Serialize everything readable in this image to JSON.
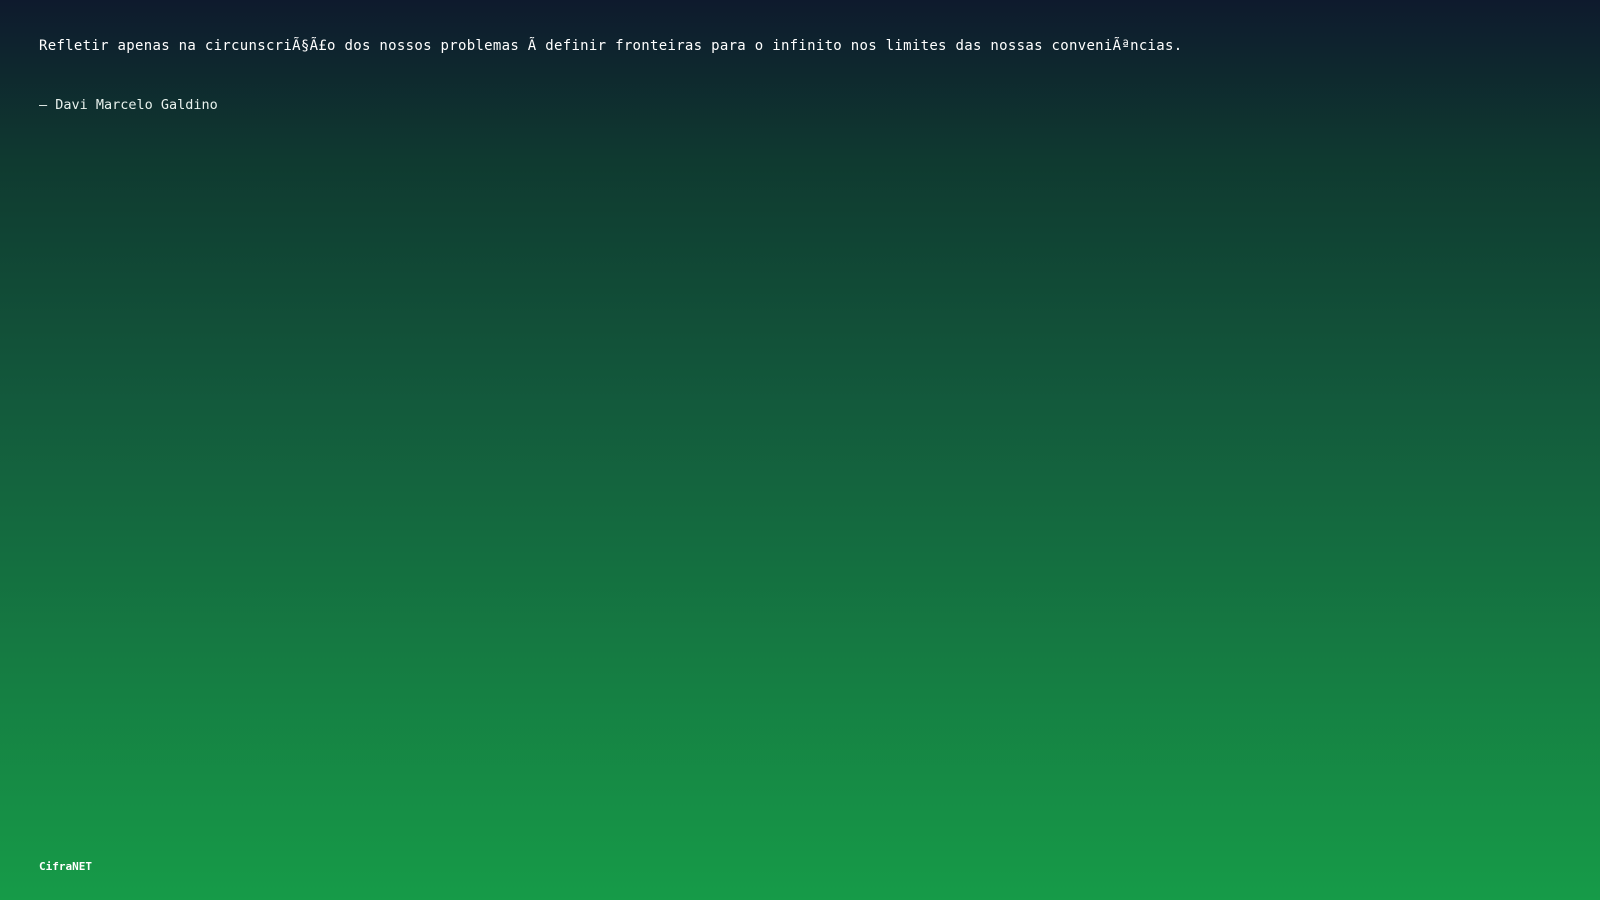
{
  "quote": {
    "text": "Refletir apenas na circunscriÃ§Ã£o dos nossos problemas Ã definir fronteiras para o infinito nos limites das nossas conveniÃªncias.",
    "author": "– Davi Marcelo Galdino"
  },
  "footer": {
    "brand": "CifraNET"
  },
  "colors": {
    "background_top": "#0e1a2d",
    "background_bottom": "#169b48",
    "text": "#ffffff"
  }
}
